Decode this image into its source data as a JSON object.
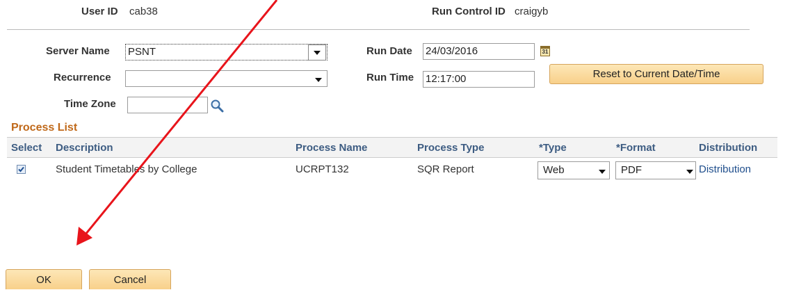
{
  "header": {
    "user_id_label": "User ID",
    "user_id_value": "cab38",
    "run_control_label": "Run Control ID",
    "run_control_value": "craigyb"
  },
  "form": {
    "server_name_label": "Server Name",
    "server_name_value": "PSNT",
    "recurrence_label": "Recurrence",
    "recurrence_value": "",
    "time_zone_label": "Time Zone",
    "time_zone_value": "",
    "run_date_label": "Run Date",
    "run_date_value": "24/03/2016",
    "run_time_label": "Run Time",
    "run_time_value": "12:17:00",
    "calendar_icon_text": "31",
    "reset_button_label": "Reset to Current Date/Time"
  },
  "process_list": {
    "title": "Process List",
    "columns": [
      "Select",
      "Description",
      "Process Name",
      "Process Type",
      "*Type",
      "*Format",
      "Distribution"
    ],
    "rows": [
      {
        "selected": true,
        "description": "Student Timetables by College",
        "process_name": "UCRPT132",
        "process_type": "SQR Report",
        "type": "Web",
        "format": "PDF",
        "distribution": "Distribution"
      }
    ]
  },
  "footer": {
    "ok_label": "OK",
    "cancel_label": "Cancel"
  },
  "colors": {
    "section_title": "#c0691a",
    "header_text": "#3d5c82",
    "link": "#1f4e8c",
    "annotation_arrow": "#e8141b",
    "button_fill": "#fbd99c"
  },
  "icons": [
    "calendar-icon",
    "magnifier-icon",
    "checkbox-checked-icon",
    "dropdown-arrow-icon"
  ]
}
